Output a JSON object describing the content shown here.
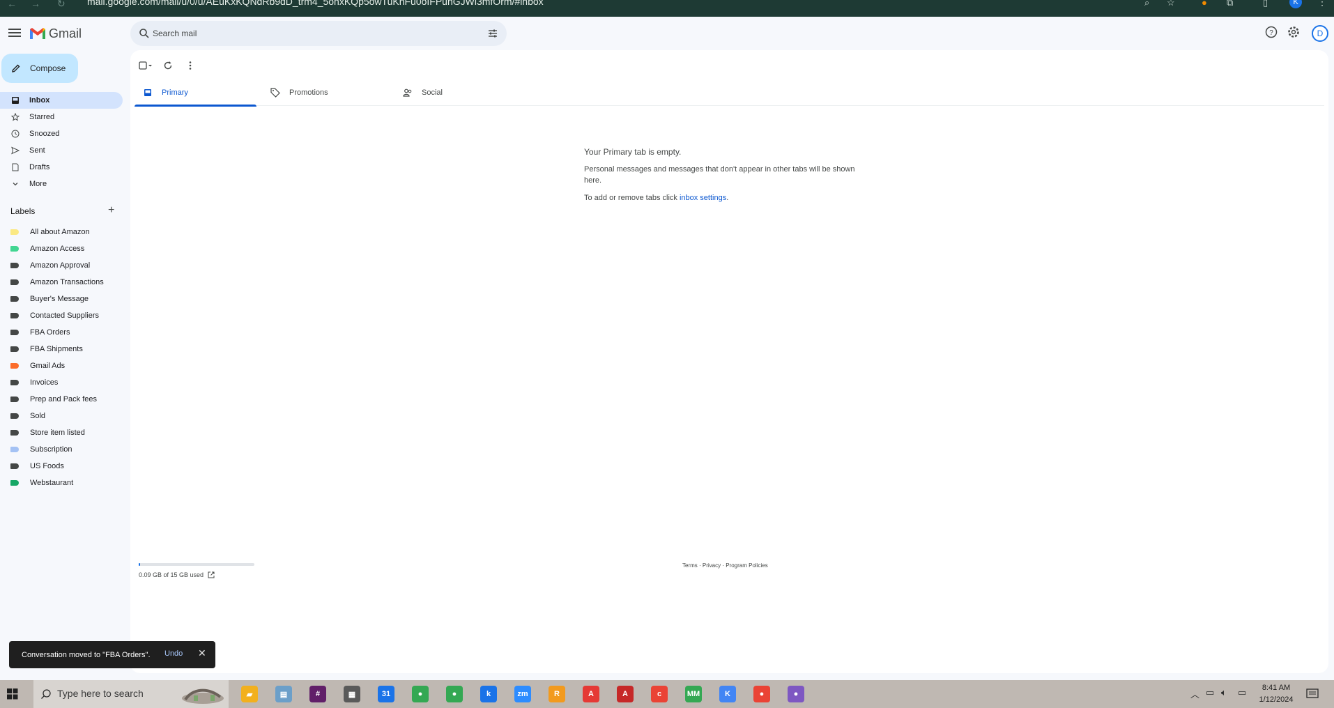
{
  "browser": {
    "url": "mail.google.com/mail/u/0/u/AEuKxKQNdRb9dD_trm4_5onxKQp5owTuKnFu0oIFPunGJWl3mfOrm/#inbox",
    "profile_initial": "K"
  },
  "header": {
    "brand": "Gmail",
    "search_placeholder": "Search mail",
    "avatar_initial": "D"
  },
  "sidebar": {
    "compose_label": "Compose",
    "items": [
      {
        "label": "Inbox",
        "icon": "inbox-icon",
        "active": true
      },
      {
        "label": "Starred",
        "icon": "star-icon"
      },
      {
        "label": "Snoozed",
        "icon": "clock-icon"
      },
      {
        "label": "Sent",
        "icon": "send-icon"
      },
      {
        "label": "Drafts",
        "icon": "draft-icon"
      },
      {
        "label": "More",
        "icon": "chevron-down-icon"
      }
    ],
    "labels_title": "Labels",
    "labels": [
      {
        "name": "All about Amazon",
        "color": "#fbe983"
      },
      {
        "name": "Amazon Access",
        "color": "#42d692"
      },
      {
        "name": "Amazon Approval",
        "color": "#444746"
      },
      {
        "name": "Amazon Transactions",
        "color": "#444746"
      },
      {
        "name": "Buyer's Message",
        "color": "#444746"
      },
      {
        "name": "Contacted Suppliers",
        "color": "#444746"
      },
      {
        "name": "FBA Orders",
        "color": "#444746"
      },
      {
        "name": "FBA Shipments",
        "color": "#444746"
      },
      {
        "name": "Gmail Ads",
        "color": "#fb6c2b"
      },
      {
        "name": "Invoices",
        "color": "#444746"
      },
      {
        "name": "Prep and Pack fees",
        "color": "#444746"
      },
      {
        "name": "Sold",
        "color": "#444746"
      },
      {
        "name": "Store item listed",
        "color": "#444746"
      },
      {
        "name": "Subscription",
        "color": "#a4c2f4"
      },
      {
        "name": "US Foods",
        "color": "#444746"
      },
      {
        "name": "Webstaurant",
        "color": "#16a766"
      }
    ]
  },
  "main": {
    "tabs": [
      {
        "label": "Primary",
        "icon": "inbox-icon",
        "active": true
      },
      {
        "label": "Promotions",
        "icon": "tag-icon"
      },
      {
        "label": "Social",
        "icon": "people-icon"
      }
    ],
    "empty_title": "Your Primary tab is empty.",
    "empty_body": "Personal messages and messages that don't appear in other tabs will be shown here.",
    "empty_settings_prefix": "To add or remove tabs click ",
    "empty_settings_link": "inbox settings",
    "empty_settings_suffix": ".",
    "storage_text": "0.09 GB of 15 GB used",
    "storage_fraction": 0.006,
    "footer": "Terms · Privacy · Program Policies"
  },
  "snackbar": {
    "message": "Conversation moved to \"FBA Orders\".",
    "action": "Undo"
  },
  "taskbar": {
    "search_placeholder": "Type here to search",
    "time": "8:41 AM",
    "date": "1/12/2024",
    "apps": [
      {
        "name": "file-explorer-icon",
        "color": "#f2b01e",
        "glyph": "▰"
      },
      {
        "name": "notes-app-icon",
        "color": "#6b9fc9",
        "glyph": "▤"
      },
      {
        "name": "slack-icon",
        "color": "#611f69",
        "glyph": "#"
      },
      {
        "name": "calculator-icon",
        "color": "#5a5a5a",
        "glyph": "▦"
      },
      {
        "name": "outlook-calendar-icon",
        "color": "#1a73e8",
        "glyph": "31"
      },
      {
        "name": "chrome-icon",
        "color": "#34a853",
        "glyph": "●"
      },
      {
        "name": "chrome-profile-icon",
        "color": "#34a853",
        "glyph": "●"
      },
      {
        "name": "chrome-k-icon",
        "color": "#1a73e8",
        "glyph": "k"
      },
      {
        "name": "zoom-icon",
        "color": "#2d8cff",
        "glyph": "zm"
      },
      {
        "name": "r-app-icon",
        "color": "#f29a1e",
        "glyph": "R"
      },
      {
        "name": "acrobat-icon",
        "color": "#e53935",
        "glyph": "A"
      },
      {
        "name": "acrobat-2-icon",
        "color": "#c62828",
        "glyph": "A"
      },
      {
        "name": "chrome-c-icon",
        "color": "#ea4335",
        "glyph": "c"
      },
      {
        "name": "chrome-mm-icon",
        "color": "#34a853",
        "glyph": "MM"
      },
      {
        "name": "chrome-k2-icon",
        "color": "#4285f4",
        "glyph": "K"
      },
      {
        "name": "chrome-3-icon",
        "color": "#ea4335",
        "glyph": "●"
      },
      {
        "name": "chrome-people-icon",
        "color": "#7e57c2",
        "glyph": "●"
      }
    ]
  }
}
